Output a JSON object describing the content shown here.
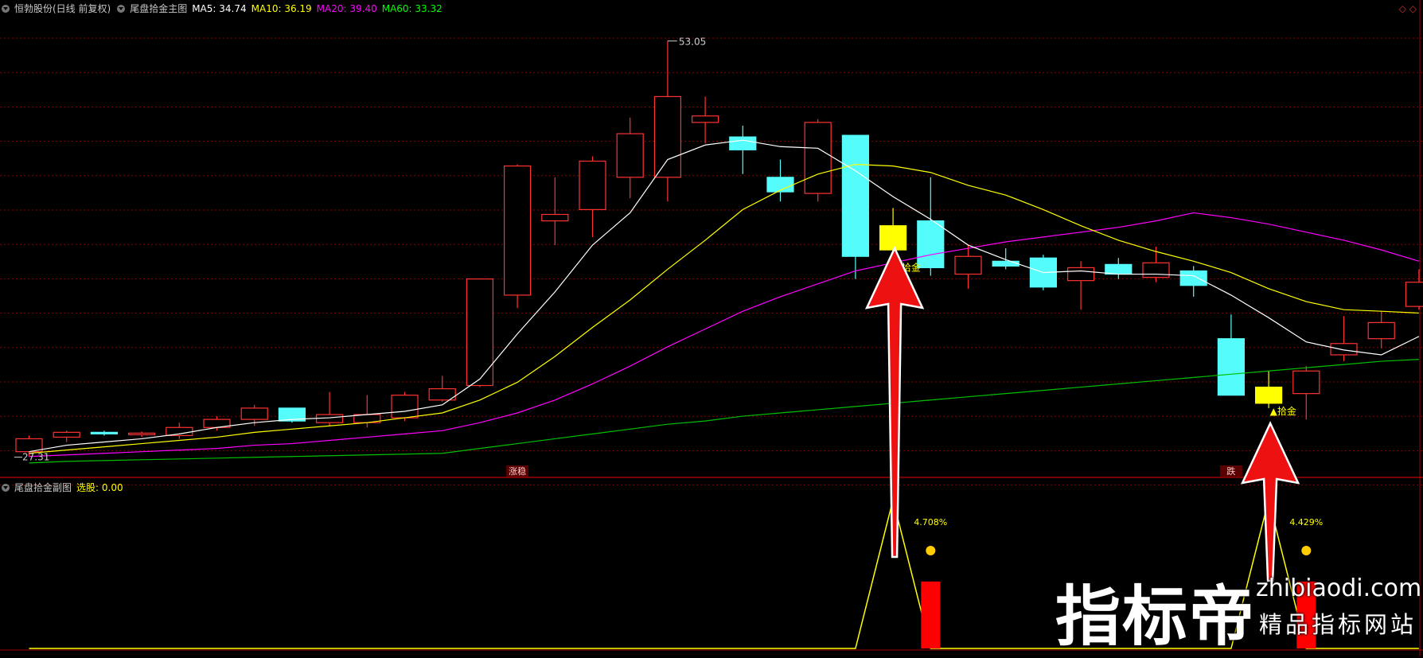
{
  "main_header": {
    "stock": "恒勃股份(日线 前复权)",
    "indicator": "尾盘拾金主图",
    "ma": [
      {
        "label": "MA5: 34.74",
        "color": "#ffffff"
      },
      {
        "label": "MA10: 36.19",
        "color": "#ffff00"
      },
      {
        "label": "MA20: 39.40",
        "color": "#ff00ff"
      },
      {
        "label": "MA60: 33.32",
        "color": "#00ff00"
      }
    ]
  },
  "sub_header": {
    "indicator": "尾盘拾金副图",
    "xuangu_label": "选股: 0.00"
  },
  "colors": {
    "up": "#ff3232",
    "down": "#54fcfc",
    "signal": "#ffff00",
    "grid": "#8b0000",
    "ma5": "#ffffff",
    "ma10": "#ffff00",
    "ma20": "#ff00ff",
    "ma60": "#00c000"
  },
  "chart_data": {
    "type": "candlestick",
    "ylim": [
      26.5,
      54.5
    ],
    "high_label": "53.05",
    "low_label": "27.31",
    "candles": [
      {
        "o": 27.6,
        "c": 28.4,
        "h": 28.6,
        "l": 27.3,
        "t": "up"
      },
      {
        "o": 28.5,
        "c": 28.8,
        "h": 28.9,
        "l": 28.2,
        "t": "up"
      },
      {
        "o": 28.8,
        "c": 28.75,
        "h": 28.9,
        "l": 28.6,
        "t": "down"
      },
      {
        "o": 28.65,
        "c": 28.75,
        "h": 28.85,
        "l": 28.5,
        "t": "up"
      },
      {
        "o": 28.6,
        "c": 29.1,
        "h": 29.4,
        "l": 28.4,
        "t": "up"
      },
      {
        "o": 29.1,
        "c": 29.6,
        "h": 29.8,
        "l": 28.9,
        "t": "up"
      },
      {
        "o": 29.6,
        "c": 30.3,
        "h": 30.5,
        "l": 29.2,
        "t": "up"
      },
      {
        "o": 30.3,
        "c": 29.5,
        "h": 30.3,
        "l": 29.4,
        "t": "down"
      },
      {
        "o": 29.4,
        "c": 29.9,
        "h": 31.3,
        "l": 29.2,
        "t": "up"
      },
      {
        "o": 29.4,
        "c": 29.9,
        "h": 31.1,
        "l": 29.1,
        "t": "up"
      },
      {
        "o": 29.7,
        "c": 31.1,
        "h": 31.3,
        "l": 29.5,
        "t": "up"
      },
      {
        "o": 30.8,
        "c": 31.5,
        "h": 32.3,
        "l": 30.7,
        "t": "up"
      },
      {
        "o": 31.7,
        "c": 38.3,
        "h": 38.3,
        "l": 31.6,
        "t": "up"
      },
      {
        "o": 37.3,
        "c": 45.3,
        "h": 45.4,
        "l": 36.5,
        "t": "up"
      },
      {
        "o": 41.9,
        "c": 42.3,
        "h": 44.6,
        "l": 40.4,
        "t": "up"
      },
      {
        "o": 42.6,
        "c": 45.6,
        "h": 45.9,
        "l": 40.9,
        "t": "up"
      },
      {
        "o": 44.6,
        "c": 47.3,
        "h": 48.3,
        "l": 43.3,
        "t": "up"
      },
      {
        "o": 44.6,
        "c": 49.6,
        "h": 53.05,
        "l": 43.1,
        "t": "up"
      },
      {
        "o": 48.0,
        "c": 48.4,
        "h": 49.6,
        "l": 46.7,
        "t": "up"
      },
      {
        "o": 47.1,
        "c": 46.3,
        "h": 47.8,
        "l": 44.8,
        "t": "down"
      },
      {
        "o": 44.6,
        "c": 43.7,
        "h": 45.7,
        "l": 43.1,
        "t": "down"
      },
      {
        "o": 43.6,
        "c": 48.0,
        "h": 48.2,
        "l": 43.1,
        "t": "up"
      },
      {
        "o": 47.2,
        "c": 39.7,
        "h": 47.2,
        "l": 38.3,
        "t": "down"
      },
      {
        "o": 41.6,
        "c": 40.1,
        "h": 42.7,
        "l": 39.9,
        "t": "signal"
      },
      {
        "o": 41.9,
        "c": 39.0,
        "h": 44.6,
        "l": 38.5,
        "t": "down"
      },
      {
        "o": 39.7,
        "c": 38.6,
        "h": 40.4,
        "l": 37.7,
        "t": "up"
      },
      {
        "o": 39.4,
        "c": 39.1,
        "h": 40.2,
        "l": 38.9,
        "t": "down"
      },
      {
        "o": 39.6,
        "c": 37.8,
        "h": 39.8,
        "l": 37.6,
        "t": "down"
      },
      {
        "o": 38.2,
        "c": 39.0,
        "h": 39.4,
        "l": 36.4,
        "t": "up"
      },
      {
        "o": 39.2,
        "c": 38.6,
        "h": 39.6,
        "l": 38.3,
        "t": "down"
      },
      {
        "o": 38.4,
        "c": 39.3,
        "h": 40.3,
        "l": 38.1,
        "t": "up"
      },
      {
        "o": 38.8,
        "c": 37.9,
        "h": 39.1,
        "l": 37.2,
        "t": "down"
      },
      {
        "o": 34.6,
        "c": 31.1,
        "h": 36.1,
        "l": 31.1,
        "t": "down"
      },
      {
        "o": 31.6,
        "c": 30.6,
        "h": 32.6,
        "l": 30.3,
        "t": "signal"
      },
      {
        "o": 31.2,
        "c": 32.6,
        "h": 32.9,
        "l": 29.6,
        "t": "up"
      },
      {
        "o": 33.6,
        "c": 34.3,
        "h": 36.0,
        "l": 33.2,
        "t": "up"
      },
      {
        "o": 34.6,
        "c": 35.6,
        "h": 36.3,
        "l": 34.0,
        "t": "up"
      },
      {
        "o": 36.6,
        "c": 38.1,
        "h": 38.9,
        "l": 36.4,
        "t": "up"
      }
    ],
    "ma5": [
      27.6,
      28.0,
      28.2,
      28.4,
      28.7,
      29.1,
      29.4,
      29.6,
      29.7,
      29.9,
      30.1,
      30.5,
      32.1,
      34.9,
      37.5,
      40.4,
      42.4,
      45.7,
      46.6,
      46.9,
      46.5,
      46.4,
      45.0,
      43.4,
      42.0,
      40.4,
      39.5,
      38.7,
      38.8,
      38.6,
      38.6,
      38.5,
      37.3,
      35.9,
      34.4,
      33.9,
      33.6,
      34.74
    ],
    "ma10": [
      27.5,
      27.7,
      27.9,
      28.1,
      28.3,
      28.5,
      28.8,
      29.0,
      29.2,
      29.4,
      29.7,
      30.0,
      30.8,
      31.9,
      33.5,
      35.3,
      37.0,
      38.9,
      40.7,
      42.6,
      43.8,
      44.8,
      45.4,
      45.3,
      44.9,
      44.1,
      43.5,
      42.6,
      41.6,
      40.7,
      40.0,
      39.4,
      38.7,
      37.7,
      36.9,
      36.4,
      36.3,
      36.19
    ],
    "ma20": [
      27.3,
      27.4,
      27.5,
      27.6,
      27.7,
      27.8,
      28.0,
      28.1,
      28.3,
      28.5,
      28.7,
      28.9,
      29.4,
      30.0,
      30.8,
      31.8,
      32.9,
      34.1,
      35.2,
      36.3,
      37.2,
      38.0,
      38.8,
      39.3,
      39.8,
      40.2,
      40.6,
      40.9,
      41.2,
      41.5,
      41.9,
      42.4,
      42.1,
      41.7,
      41.2,
      40.7,
      40.1,
      39.4
    ],
    "ma60": [
      26.9,
      27.0,
      27.05,
      27.1,
      27.15,
      27.2,
      27.25,
      27.3,
      27.35,
      27.4,
      27.45,
      27.5,
      27.8,
      28.1,
      28.4,
      28.7,
      29.0,
      29.3,
      29.5,
      29.8,
      30.0,
      30.2,
      30.4,
      30.6,
      30.8,
      31.0,
      31.2,
      31.4,
      31.6,
      31.8,
      32.0,
      32.2,
      32.4,
      32.6,
      32.8,
      33.0,
      33.2,
      33.32
    ],
    "labels": [
      {
        "i": 23,
        "text": "▲拾金",
        "price": 38.8
      },
      {
        "i": 33,
        "text": "▲拾金",
        "price": 29.9
      }
    ],
    "bottom_tags": [
      {
        "i": 13,
        "text": "涨稳"
      },
      {
        "i": 32,
        "text": "跌"
      }
    ],
    "sub": {
      "type": "line+bar",
      "ylim": [
        0,
        1
      ],
      "line": [
        0,
        0,
        0,
        0,
        0,
        0,
        0,
        0,
        0,
        0,
        0,
        0,
        0,
        0,
        0,
        0,
        0,
        0,
        0,
        0,
        0,
        0,
        0,
        1,
        0,
        0,
        0,
        0,
        0,
        0,
        0,
        0,
        0,
        1,
        0,
        0,
        0,
        0
      ],
      "bars": [
        {
          "i": 24,
          "value": 1
        },
        {
          "i": 34,
          "value": 1
        }
      ],
      "pct_labels": [
        {
          "i": 24,
          "text": "4.708%"
        },
        {
          "i": 34,
          "text": "4.429%"
        }
      ]
    }
  },
  "watermark": {
    "cn": "指标帝",
    "url": "zhibiaodi.com",
    "sub": "精品指标网站"
  }
}
